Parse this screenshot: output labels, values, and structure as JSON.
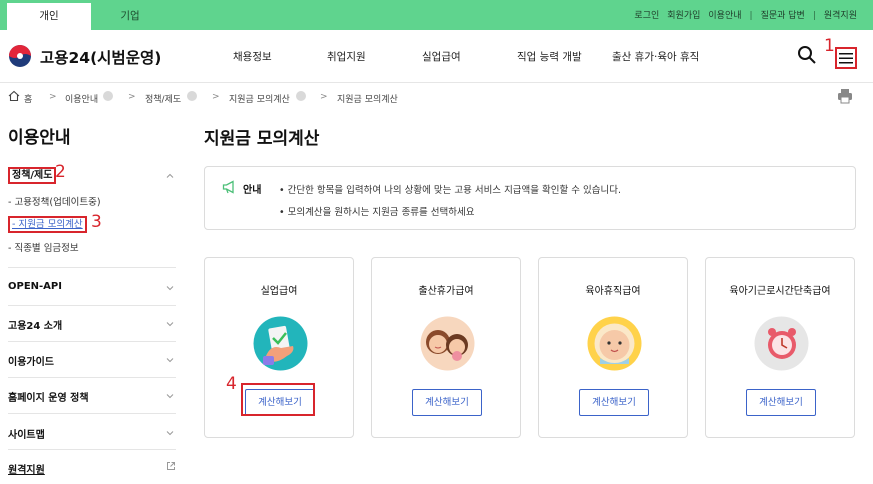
{
  "topbar": {
    "tab_personal": "개인",
    "tab_business": "기업",
    "links": [
      "로그인",
      "회원가입",
      "이용안내",
      "질문과 답변",
      "원격지원"
    ]
  },
  "header": {
    "brand": "고용24(시범운영)",
    "nav": [
      "채용정보",
      "취업지원",
      "실업급여",
      "직업 능력 개발",
      "출산 휴가·육아 휴직"
    ]
  },
  "breadcrumb": [
    "홈",
    "이용안내",
    "정책/제도",
    "지원금 모의계산",
    "지원금 모의계산"
  ],
  "sidebar": {
    "title": "이용안내",
    "sections": [
      "정책/제도",
      "OPEN-API",
      "고용24 소개",
      "이용가이드",
      "홈페이지 운영 정책",
      "사이트맵",
      "원격지원"
    ],
    "sub_items": [
      "- 고용정책(업데이트중)",
      "- 지원금 모의계산",
      "- 직종별 임금정보"
    ]
  },
  "main": {
    "title": "지원금 모의계산",
    "notice_label": "안내",
    "notice_lines": [
      "간단한 항목을 입력하여 나의 상황에 맞는 고용 서비스 지급액을 확인할 수 있습니다.",
      "모의계산을 원하시는 지원금 종류를 선택하세요"
    ],
    "cards": [
      {
        "title": "실업급여",
        "button": "계산해보기"
      },
      {
        "title": "출산휴가급여",
        "button": "계산해보기"
      },
      {
        "title": "육아휴직급여",
        "button": "계산해보기"
      },
      {
        "title": "육아기근로시간단축급여",
        "button": "계산해보기"
      }
    ]
  },
  "annotations": [
    "1",
    "2",
    "3",
    "4"
  ],
  "colors": {
    "topbar": "#5fd48e",
    "highlight": "#d8252c",
    "button": "#3b63c9"
  }
}
